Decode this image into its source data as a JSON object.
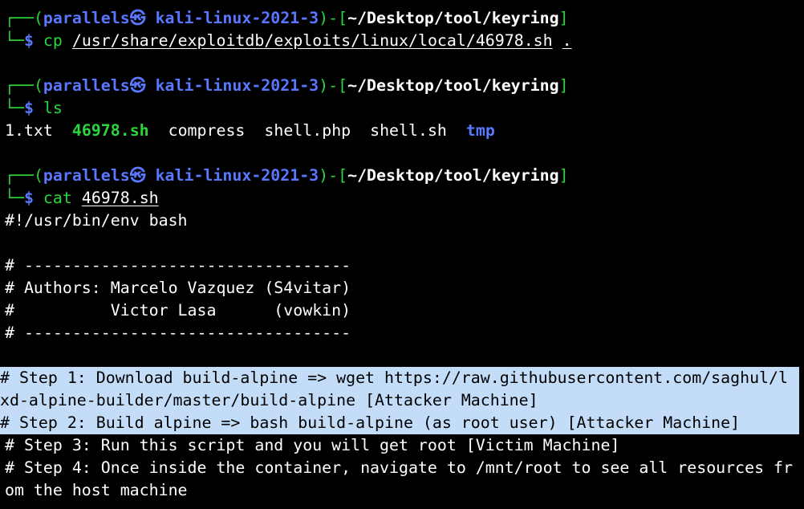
{
  "prompt": {
    "user_host": "parallels㉿ kali-linux-2021-3",
    "left_paren": "(",
    "right_paren": ")",
    "dash": "-",
    "left_bracket": "[",
    "right_bracket": "]",
    "top_corner": "┌──",
    "bottom_corner": "└─",
    "dollar": "$"
  },
  "blocks": [
    {
      "path": "~/Desktop/tool/keyring",
      "command": "cp",
      "args": [
        "/usr/share/exploitdb/exploits/linux/local/46978.sh",
        "."
      ]
    },
    {
      "path": "~/Desktop/tool/keyring",
      "command": "ls",
      "args": []
    },
    {
      "path": "~/Desktop/tool/keyring",
      "command": "cat",
      "args": [
        "46978.sh"
      ]
    }
  ],
  "ls_output": {
    "items": [
      {
        "name": "1.txt",
        "kind": "file"
      },
      {
        "name": "46978.sh",
        "kind": "exec"
      },
      {
        "name": "compress",
        "kind": "file"
      },
      {
        "name": "shell.php",
        "kind": "file"
      },
      {
        "name": "shell.sh",
        "kind": "file"
      },
      {
        "name": "tmp",
        "kind": "dir"
      }
    ]
  },
  "file_lines": {
    "shebang": "#!/usr/bin/env bash",
    "sep1": "# ----------------------------------",
    "authors1": "# Authors: Marcelo Vazquez (S4vitar)",
    "authors2": "#          Victor Lasa      (vowkin)",
    "sep2": "# ----------------------------------",
    "step1a": "# Step 1: Download build-alpine => wget https://raw.githubusercontent.com/saghul/l",
    "step1b": "xd-alpine-builder/master/build-alpine [Attacker Machine]",
    "step2": "# Step 2: Build alpine => bash build-alpine (as root user) [Attacker Machine]",
    "step3": "# Step 3: Run this script and you will get root [Victim Machine]",
    "step4a": "# Step 4: Once inside the container, navigate to /mnt/root to see all resources fr",
    "step4b": "om the host machine"
  },
  "colors": {
    "background": "#000000",
    "prompt_green": "#2bd63b",
    "prompt_blue": "#5a78ff",
    "selection": "#c3ddf9"
  }
}
